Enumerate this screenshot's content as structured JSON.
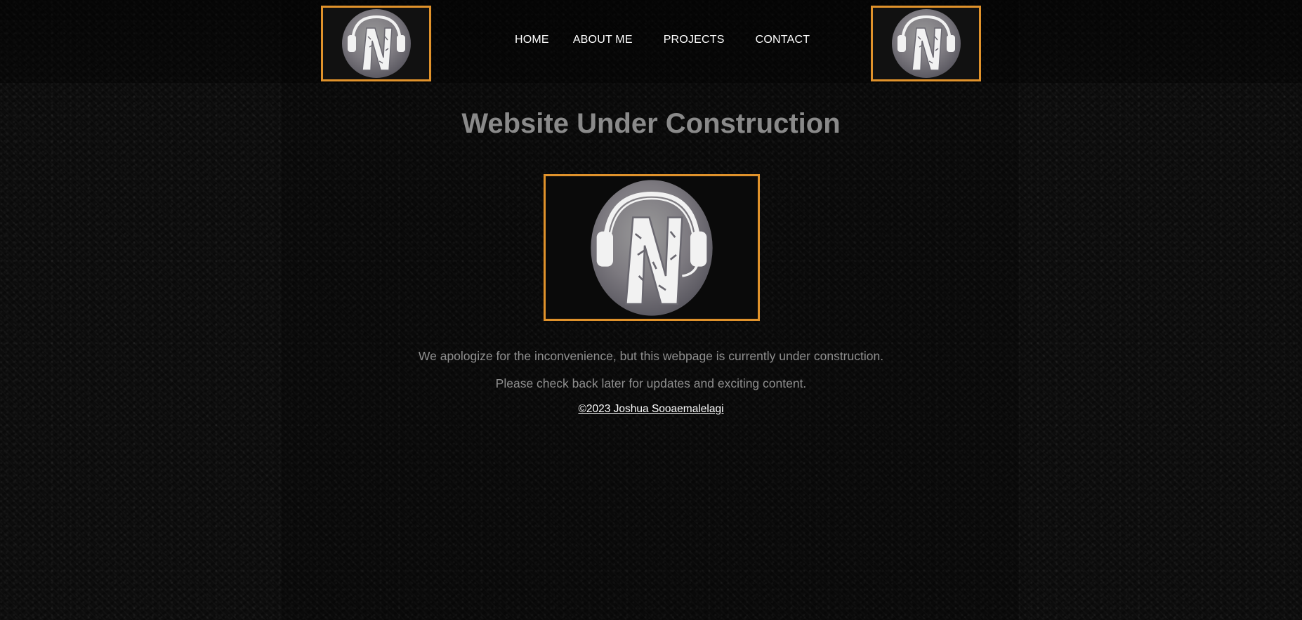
{
  "nav": {
    "items": [
      {
        "label": "HOME"
      },
      {
        "label": "ABOUT ME"
      },
      {
        "label": "PROJECTS"
      },
      {
        "label": "CONTACT"
      }
    ]
  },
  "main": {
    "title": "Website Under Construction",
    "message_line1": "We apologize for the inconvenience, but this webpage is currently under construction.",
    "message_line2": "Please check back later for updates and exciting content."
  },
  "footer": {
    "copyright": "©2023 Joshua Sooaemalelagi"
  },
  "colors": {
    "accent_border": "#e0922b",
    "title": "#8a8a8a",
    "body_text": "#8f8f8f",
    "nav_text": "#ffffff"
  },
  "icons": {
    "logo": "headphones-n-logo-icon"
  }
}
